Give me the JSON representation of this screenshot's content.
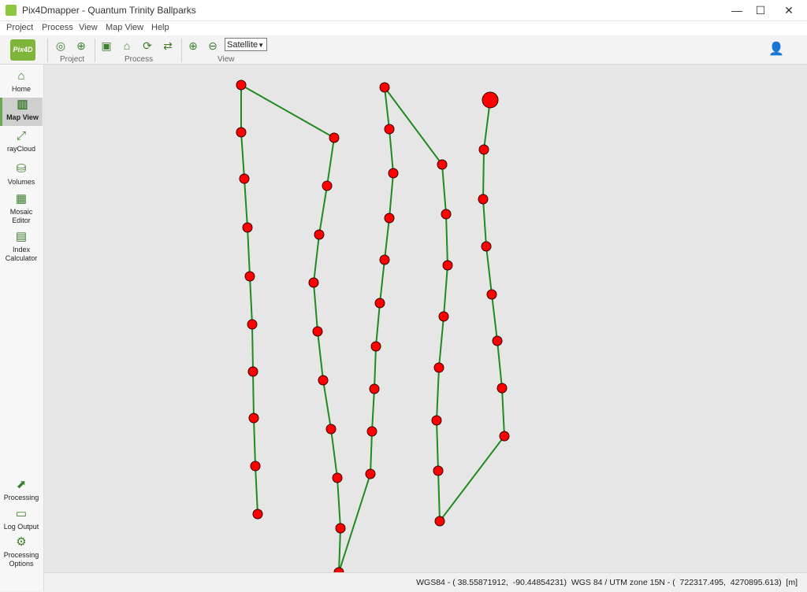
{
  "window": {
    "title": "Pix4Dmapper - Quantum Trinity Ballparks",
    "minimize": "—",
    "maximize": "☐",
    "close": "✕"
  },
  "menu": [
    "Project",
    "Process",
    "View",
    "Map View",
    "Help"
  ],
  "ribbon": {
    "logo": "Pix4D",
    "groups": {
      "project": "Project",
      "process": "Process",
      "view": "View"
    },
    "basemap_selected": "Satellite"
  },
  "sidebar": {
    "items": [
      {
        "label": "Home",
        "icon": "home-icon"
      },
      {
        "label": "Map View",
        "icon": "map-icon",
        "active": true
      },
      {
        "label": "rayCloud",
        "icon": "raycloud-icon"
      },
      {
        "label": "Volumes",
        "icon": "volumes-icon"
      },
      {
        "label": "Mosaic Editor",
        "icon": "mosaic-editor-icon"
      },
      {
        "label": "Index Calculator",
        "icon": "index-calculator-icon"
      }
    ],
    "bottom": [
      {
        "label": "Processing",
        "icon": "processing-icon"
      },
      {
        "label": "Log Output",
        "icon": "log-output-icon"
      },
      {
        "label": "Processing Options",
        "icon": "gear-icon"
      }
    ]
  },
  "status": {
    "text": "WGS84 - ( 38.55871912,  -90.44854231)  WGS 84 / UTM zone 15N - (  722317.495,  4270895.613)  [m]"
  },
  "colors": {
    "accent": "#6aa84f",
    "flight_line": "#1f8a1f",
    "camera_point": "#ff0000"
  }
}
